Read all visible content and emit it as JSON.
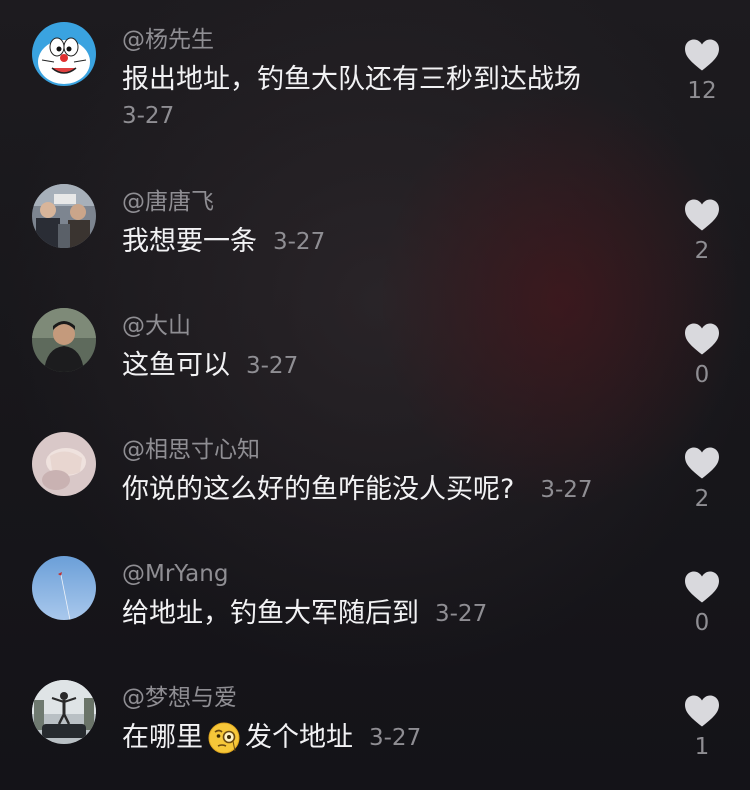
{
  "comments": [
    {
      "username": "@杨先生",
      "text": "报出地址，钓鱼大队还有三秒到达战场",
      "date": "3-27",
      "likes": "12",
      "avatar_icon": "doraemon-avatar-icon"
    },
    {
      "username": "@唐唐飞",
      "text": "我想要一条",
      "date": "3-27",
      "likes": "2",
      "avatar_icon": "people-photo-avatar-icon"
    },
    {
      "username": "@大山",
      "text": "这鱼可以",
      "date": "3-27",
      "likes": "0",
      "avatar_icon": "man-portrait-avatar-icon"
    },
    {
      "username": "@相思寸心知",
      "text": "你说的这么好的鱼咋能没人买呢?",
      "date": "3-27",
      "likes": "2",
      "avatar_icon": "hand-photo-avatar-icon"
    },
    {
      "username": "@MrYang",
      "text": "给地址，钓鱼大军随后到",
      "date": "3-27",
      "likes": "0",
      "avatar_icon": "blue-sky-avatar-icon"
    },
    {
      "username": "@梦想与爱",
      "text_before": "在哪里",
      "text_after": "发个地址",
      "emoji": "monocle-face-emoji",
      "date": "3-27",
      "likes": "1",
      "avatar_icon": "person-on-car-avatar-icon"
    }
  ],
  "colors": {
    "background": "#1a191d",
    "primary_text": "#f2f2f4",
    "secondary_text": "#8f8e93",
    "heart": "#d9d9dd"
  }
}
